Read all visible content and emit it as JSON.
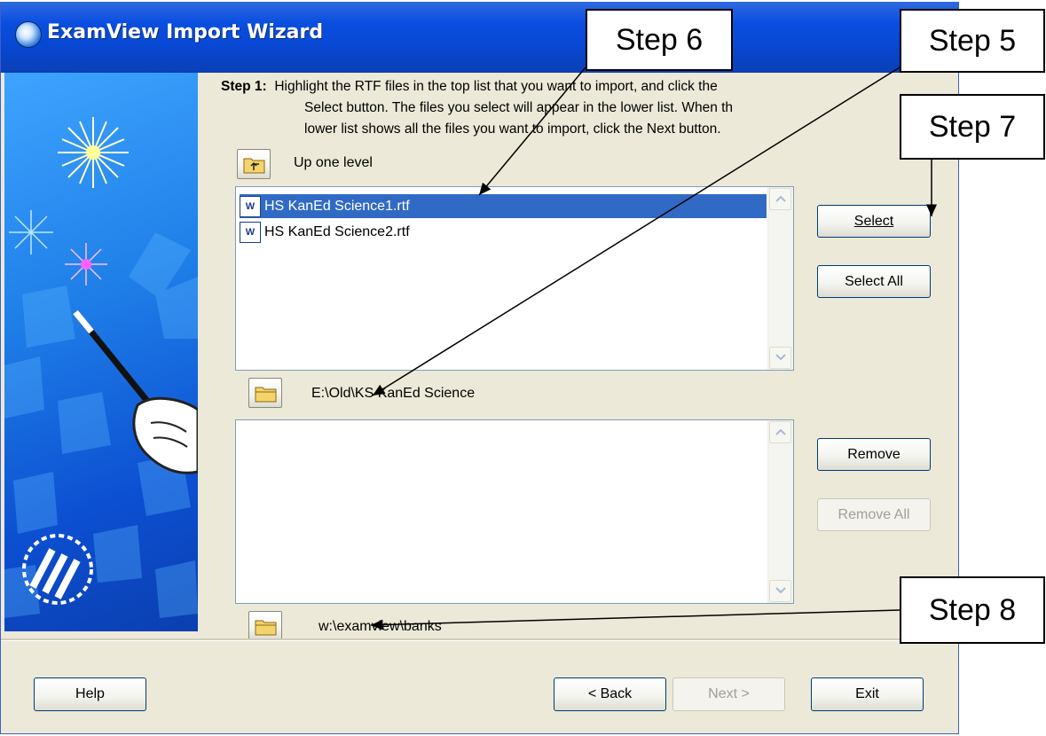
{
  "window": {
    "title": "ExamView Import Wizard"
  },
  "instructions": {
    "step_label": "Step 1:",
    "line1": "Highlight the RTF files in the top list that you want to import, and click the",
    "line2": "Select button.  The files you select will appear in the lower list.  When th",
    "line3": "lower list shows all the files you want to import, click the Next button."
  },
  "navigation": {
    "up_one_level": "Up one level",
    "source_path": "E:\\Old\\KS KanEd Science",
    "dest_path": "w:\\examview\\banks"
  },
  "source_list": {
    "files": [
      {
        "name": "HS KanEd Science1.rtf",
        "selected": true
      },
      {
        "name": "HS KanEd Science2.rtf",
        "selected": false
      }
    ]
  },
  "buttons": {
    "select": "Select",
    "select_all": "Select All",
    "remove": "Remove",
    "remove_all": "Remove All",
    "help": "Help",
    "back": "< Back",
    "next": "Next >",
    "exit": "Exit"
  },
  "callouts": {
    "step6": "Step 6",
    "step5": "Step 5",
    "step7": "Step 7",
    "step8": "Step 8"
  },
  "colors": {
    "title_bar": "#0848d4",
    "selection": "#316ac5",
    "dialog_bg": "#ece9d8"
  }
}
